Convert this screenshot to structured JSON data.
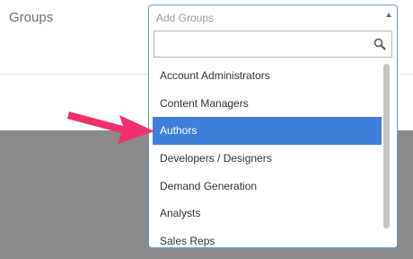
{
  "field": {
    "label": "Groups"
  },
  "select": {
    "placeholder": "Add Groups",
    "search_value": ""
  },
  "dropdown": {
    "options": [
      "Account Administrators",
      "Content Managers",
      "Authors",
      "Developers / Designers",
      "Demand Generation",
      "Analysts",
      "Sales Reps"
    ],
    "highlighted": "Authors"
  },
  "colors": {
    "highlight": "#3f7fdc",
    "focus_border": "#5b9bd5",
    "annotation_arrow": "#f0306a",
    "backdrop": "#8a8a8a"
  },
  "icons": {
    "search": "search-icon",
    "caret": "caret-up-icon",
    "annotation": "annotation-arrow-icon"
  }
}
